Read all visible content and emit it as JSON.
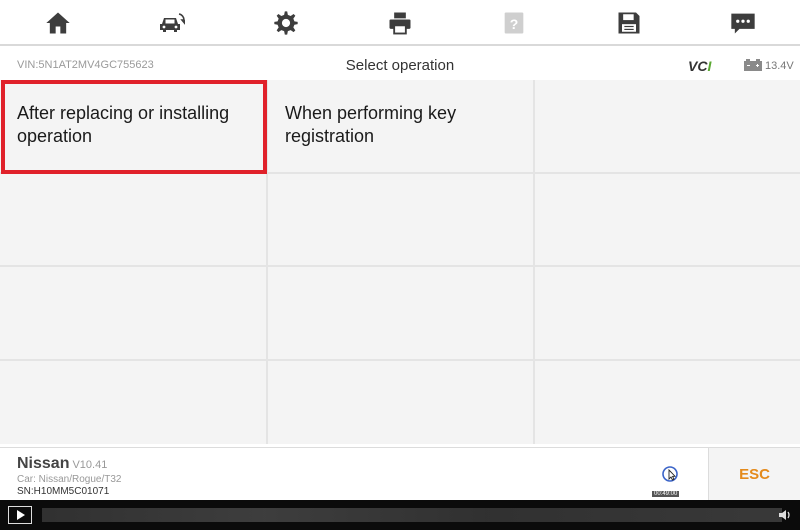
{
  "toolbar": {
    "buttons": [
      {
        "name": "home-icon"
      },
      {
        "name": "vehicle-swap-icon"
      },
      {
        "name": "gear-icon"
      },
      {
        "name": "printer-icon"
      },
      {
        "name": "help-icon",
        "disabled": true
      },
      {
        "name": "save-icon"
      },
      {
        "name": "feedback-icon"
      }
    ]
  },
  "status": {
    "vin": "VIN:5N1AT2MV4GC755623",
    "title": "Select operation",
    "vci_main": "VC",
    "vci_suffix": "I",
    "voltage": "13.4V"
  },
  "grid": {
    "cells": [
      {
        "label": "After replacing or installing operation"
      },
      {
        "label": "When performing key registration"
      },
      {
        "label": ""
      },
      {
        "label": ""
      },
      {
        "label": ""
      },
      {
        "label": ""
      },
      {
        "label": ""
      },
      {
        "label": ""
      },
      {
        "label": ""
      },
      {
        "label": ""
      },
      {
        "label": ""
      },
      {
        "label": ""
      }
    ]
  },
  "footer": {
    "make": "Nissan",
    "version": "V10.41",
    "car": "Car: Nissan/Rogue/T32",
    "sn": "SN:H10MM5C01071",
    "cursor_time": "00:49:00",
    "esc_label": "ESC"
  },
  "colors": {
    "highlight": "#e0212a",
    "esc": "#e48a1b",
    "vci_accent": "#5aa832"
  }
}
